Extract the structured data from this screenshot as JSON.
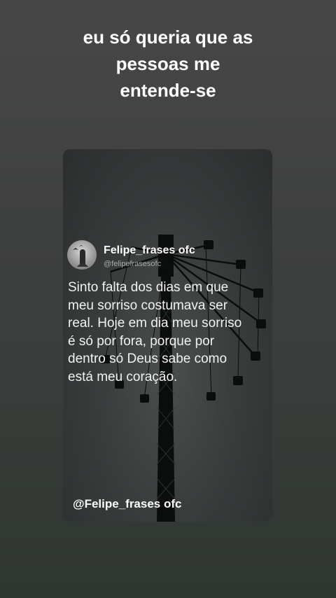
{
  "caption": {
    "lines": [
      "eu só queria que as",
      "pessoas me",
      "entende-se"
    ]
  },
  "post": {
    "author_name": "Felipe_frases ofc",
    "author_handle": "@felipefrasesofc",
    "text_lines": [
      "Sinto falta dos dias em que",
      "meu sorriso costumava ser",
      "real. Hoje em dia meu sorriso",
      "é só por fora, porque por",
      "dentro só Deus sabe como",
      "está meu coração."
    ],
    "watermark": "@Felipe_frases ofc"
  },
  "colors": {
    "background": "#3f413f",
    "card": "#373a3a",
    "text": "#ffffff",
    "handle": "#a9acab"
  }
}
